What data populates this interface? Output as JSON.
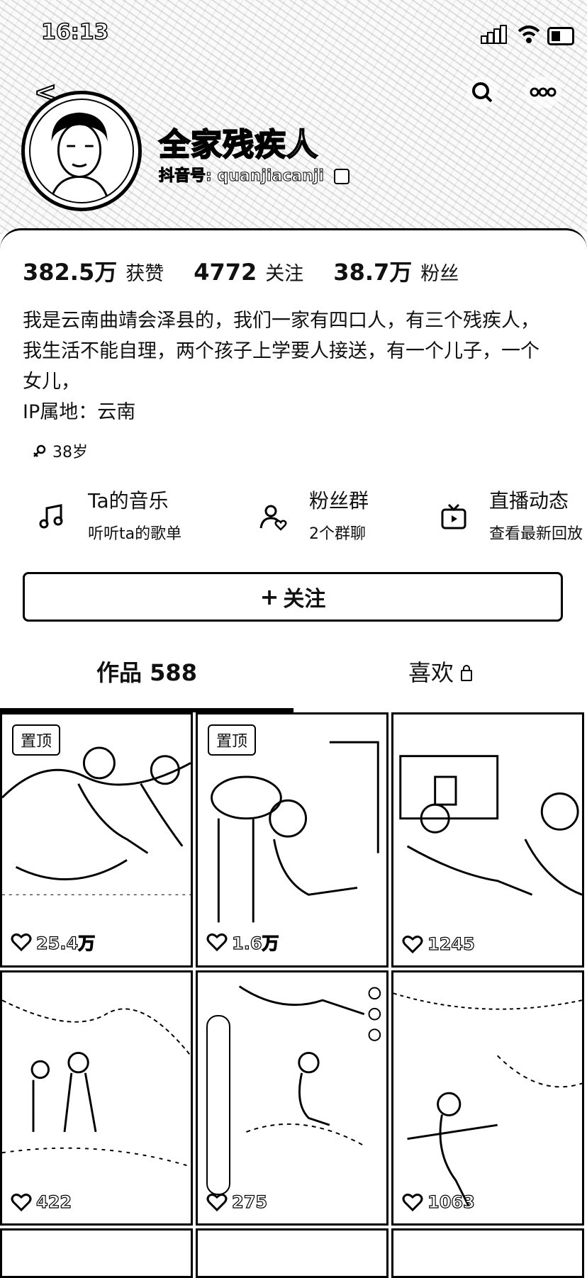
{
  "status_bar": {
    "time": "16:13"
  },
  "profile": {
    "nickname": "全家残疾人",
    "douyin_id": "抖音号: quanjiacanji",
    "stats": [
      {
        "value": "382.5万",
        "label": "获赞"
      },
      {
        "value": "4772",
        "label": "关注"
      },
      {
        "value": "38.7万",
        "label": "粉丝"
      }
    ],
    "bio": "我是云南曲靖会泽县的，我们一家有四口人，有三个残疾人，我生活不能自理，两个孩子上学要人接送，有一个儿子，一个女儿，",
    "ip_location": "IP属地：云南",
    "age_tag": "38岁"
  },
  "features": [
    {
      "title": "Ta的音乐",
      "subtitle": "听听ta的歌单",
      "icon": "music-note-icon"
    },
    {
      "title": "粉丝群",
      "subtitle": "2个群聊",
      "icon": "fan-group-icon"
    },
    {
      "title": "直播动态",
      "subtitle": "查看最新回放",
      "icon": "tv-icon"
    }
  ],
  "follow_button": {
    "label": "关注",
    "icon": "plus-icon"
  },
  "tabs": [
    {
      "label": "作品 588",
      "active": true
    },
    {
      "label": "喜欢",
      "locked": true
    }
  ],
  "videos": [
    {
      "pinned_label": "置顶",
      "likes": "25.4万"
    },
    {
      "pinned_label": "置顶",
      "likes": "1.6万"
    },
    {
      "pinned_label": "",
      "likes": "1245"
    },
    {
      "pinned_label": "",
      "likes": "422"
    },
    {
      "pinned_label": "",
      "likes": "275"
    },
    {
      "pinned_label": "",
      "likes": "1063"
    }
  ]
}
